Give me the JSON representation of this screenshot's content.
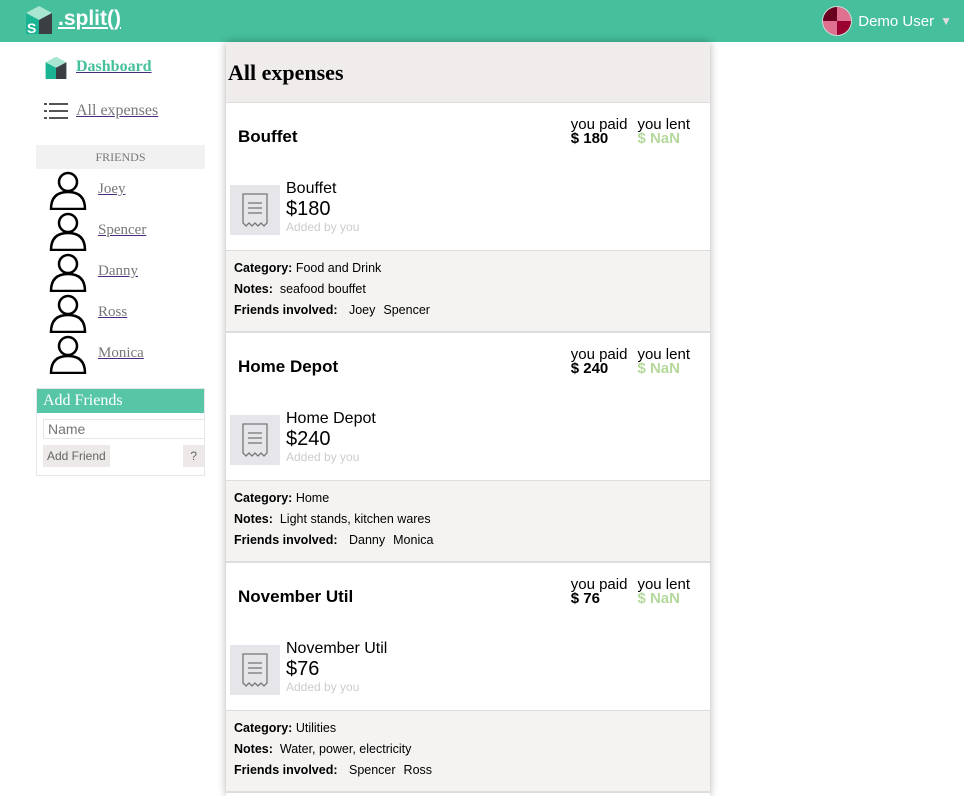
{
  "header": {
    "logo": ".split()",
    "user": "Demo User",
    "avatar_colors": [
      "#6b0020",
      "#e07090",
      "#e07090",
      "#9a0030"
    ]
  },
  "sidebar": {
    "dashboard": "Dashboard",
    "all_expenses": "All expenses",
    "friends_heading": "FRIENDS",
    "friends": [
      "Joey",
      "Spencer",
      "Danny",
      "Ross",
      "Monica"
    ],
    "add_friends": {
      "title": "Add Friends",
      "placeholder": "Name",
      "button": "Add Friend",
      "help": "?"
    }
  },
  "main": {
    "title": "All expenses",
    "labels": {
      "you_paid": "you paid",
      "you_lent": "you lent",
      "added_by": "Added by you",
      "category": "Category:",
      "notes": "Notes:",
      "friends": "Friends involved:"
    },
    "expenses": [
      {
        "title": "Bouffet",
        "paid": "$ 180",
        "lent": "$ NaN",
        "amount": "$180",
        "category": "Food and Drink",
        "notes": "seafood bouffet",
        "friends": [
          "Joey",
          "Spencer"
        ]
      },
      {
        "title": "Home Depot",
        "paid": "$ 240",
        "lent": "$ NaN",
        "amount": "$240",
        "category": "Home",
        "notes": "Light stands, kitchen wares",
        "friends": [
          "Danny",
          "Monica"
        ]
      },
      {
        "title": "November Util",
        "paid": "$ 76",
        "lent": "$ NaN",
        "amount": "$76",
        "category": "Utilities",
        "notes": "Water, power, electricity",
        "friends": [
          "Spencer",
          "Ross"
        ]
      }
    ]
  }
}
